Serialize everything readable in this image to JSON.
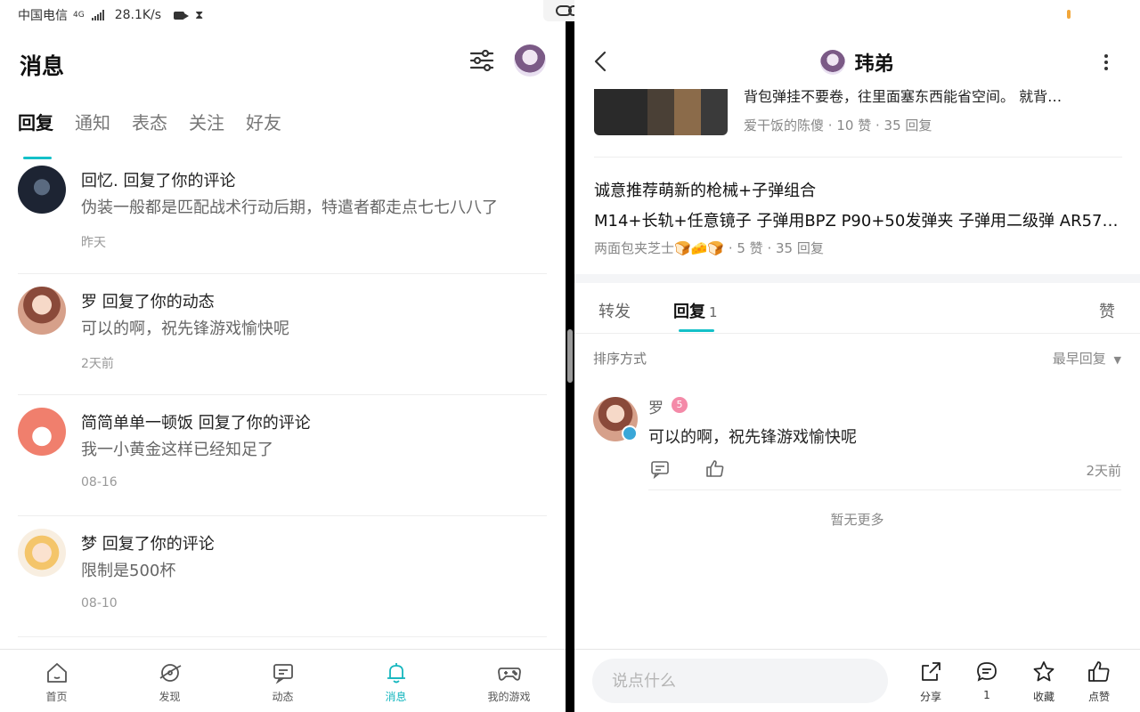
{
  "statusbar": {
    "carrier": "中国电信",
    "net_type": "4G",
    "speed": "28.1K/s"
  },
  "left": {
    "title": "消息",
    "tabs": [
      {
        "label": "回复",
        "active": true
      },
      {
        "label": "通知"
      },
      {
        "label": "表态"
      },
      {
        "label": "关注"
      },
      {
        "label": "好友"
      }
    ],
    "messages": [
      {
        "title": "回忆. 回复了你的评论",
        "body": "伪装一般都是匹配战术行动后期，特遣者都走点七七八八了",
        "time": "昨天"
      },
      {
        "title": "罗 回复了你的动态",
        "body": "可以的啊，祝先锋游戏愉快呢",
        "time": "2天前"
      },
      {
        "title": "简简单单一顿饭 回复了你的评论",
        "body": "我一小黄金这样已经知足了",
        "time": "08-16"
      },
      {
        "title": "梦 回复了你的评论",
        "body": "限制是500杯",
        "time": "08-10"
      }
    ],
    "nav": [
      {
        "label": "首页",
        "icon": "home-icon"
      },
      {
        "label": "发现",
        "icon": "discover-icon"
      },
      {
        "label": "动态",
        "icon": "feed-icon"
      },
      {
        "label": "消息",
        "icon": "bell-icon",
        "active": true
      },
      {
        "label": "我的游戏",
        "icon": "gamepad-icon"
      }
    ]
  },
  "right": {
    "user_name": "玮弟",
    "post1": {
      "desc": "背包弹挂不要卷，往里面塞东西能省空间。 就背…",
      "author": "爱干饭的陈傻",
      "likes": "10 赞",
      "replies": "35 回复"
    },
    "post2": {
      "title": "诚意推荐萌新的枪械+子弹组合",
      "line2": "M14+长轨+任意镜子 子弹用BPZ P90+50发弹夹 子弹用二级弹 AR57+…",
      "author": "两面包夹芝士🍞🧀🍞",
      "likes": "5 赞",
      "replies": "35 回复"
    },
    "tabs": {
      "forward": "转发",
      "reply": "回复",
      "reply_count": "1",
      "like": "赞"
    },
    "sort_label": "排序方式",
    "sort_value": "最早回复",
    "reply": {
      "name": "罗",
      "level": "5",
      "text": "可以的啊，祝先锋游戏愉快呢",
      "time": "2天前"
    },
    "no_more": "暂无更多",
    "input_placeholder": "说点什么",
    "actions": [
      {
        "label": "分享",
        "icon": "share-icon"
      },
      {
        "label": "1",
        "icon": "comment-icon"
      },
      {
        "label": "收藏",
        "icon": "star-icon"
      },
      {
        "label": "点赞",
        "icon": "thumb-up-icon"
      }
    ]
  },
  "colors": {
    "accent": "#14c0c8"
  }
}
